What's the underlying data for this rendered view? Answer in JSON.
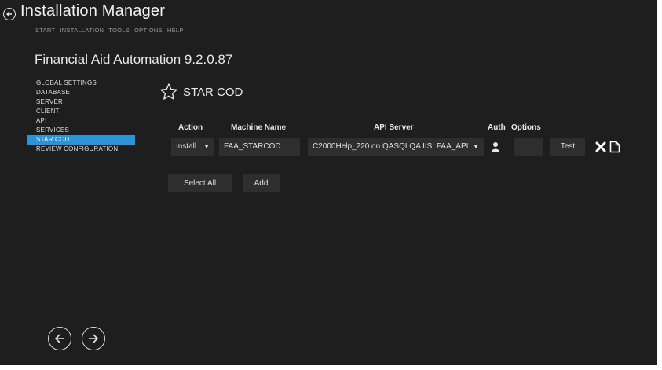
{
  "app": {
    "title": "Installation Manager",
    "menu": [
      "START",
      "INSTALLATION",
      "TOOLS",
      "OPTIONS",
      "HELP"
    ]
  },
  "product_title": "Financial Aid Automation 9.2.0.87",
  "sidebar": {
    "items": [
      {
        "label": "GLOBAL SETTINGS",
        "active": false
      },
      {
        "label": "DATABASE",
        "active": false
      },
      {
        "label": "SERVER",
        "active": false
      },
      {
        "label": "CLIENT",
        "active": false
      },
      {
        "label": "API",
        "active": false
      },
      {
        "label": "SERVICES",
        "active": false
      },
      {
        "label": "STAR COD",
        "active": true
      },
      {
        "label": "REVIEW CONFIGURATION",
        "active": false
      }
    ]
  },
  "section": {
    "title": "STAR COD",
    "icon": "star-outline-icon"
  },
  "table": {
    "headers": {
      "action": "Action",
      "machine_name": "Machine Name",
      "api_server": "API Server",
      "auth": "Auth",
      "options": "Options"
    },
    "row": {
      "action": "Install",
      "machine_name": "FAA_STARCOD",
      "api_server": "C2000Help_220 on QASQLQA IIS: FAA_API",
      "auth_icon": "user-icon",
      "options_label": "...",
      "test_label": "Test",
      "delete_icon": "close-icon",
      "copy_icon": "copy-icon"
    }
  },
  "buttons": {
    "select_all": "Select All",
    "add": "Add"
  },
  "colors": {
    "background": "#1e1e1e",
    "accent": "#2b93d8",
    "control": "#2e2e2e"
  }
}
